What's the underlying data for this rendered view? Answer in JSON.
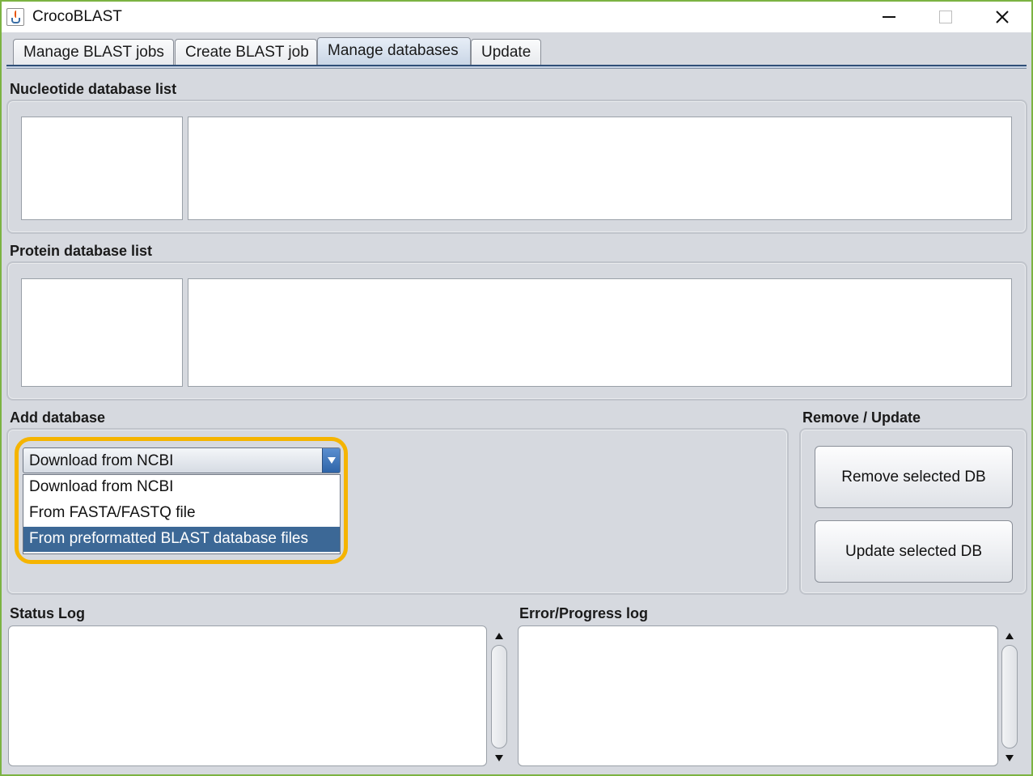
{
  "window": {
    "title": "CrocoBLAST"
  },
  "tabs": [
    {
      "label": "Manage BLAST jobs"
    },
    {
      "label": "Create BLAST job"
    },
    {
      "label": "Manage databases",
      "active": true
    },
    {
      "label": "Update"
    }
  ],
  "nucleotide": {
    "title": "Nucleotide database list"
  },
  "protein": {
    "title": "Protein database list"
  },
  "add_database": {
    "title": "Add database",
    "selected": "Download from NCBI",
    "options": [
      "Download from NCBI",
      "From FASTA/FASTQ file",
      "From preformatted BLAST database files"
    ],
    "highlighted_option": "From preformatted BLAST database files",
    "highlight_color": "#f5b400"
  },
  "remove_update": {
    "title": "Remove / Update",
    "remove_label": "Remove selected DB",
    "update_label": "Update selected DB"
  },
  "logs": {
    "status_title": "Status Log",
    "error_title": "Error/Progress log"
  }
}
